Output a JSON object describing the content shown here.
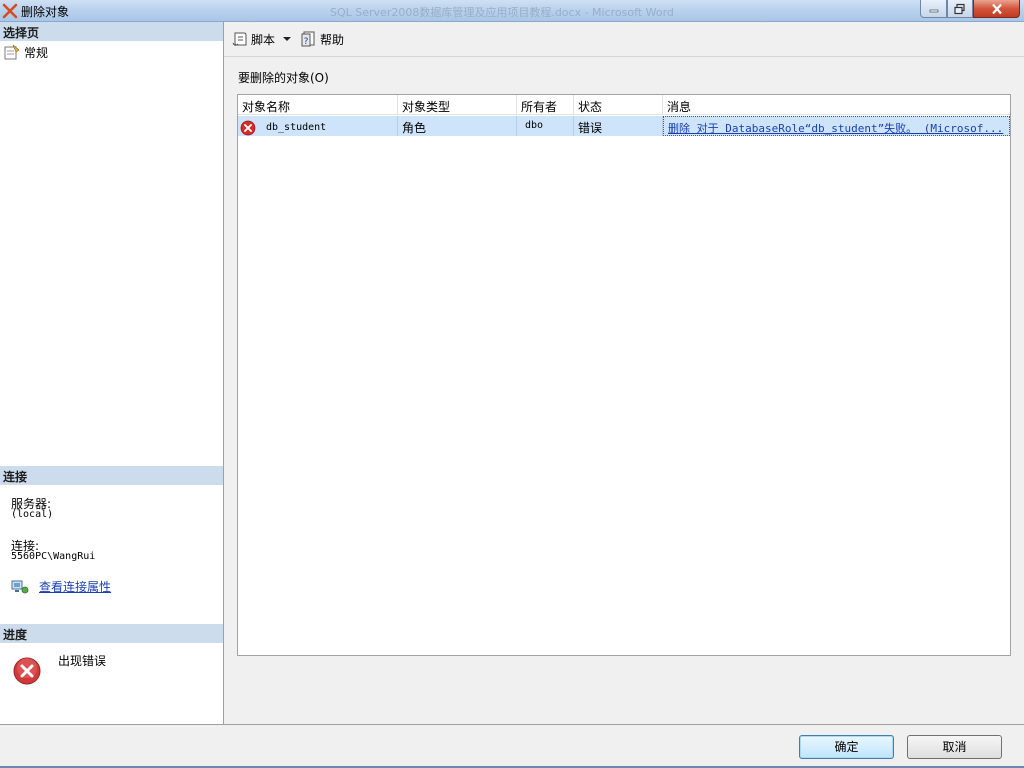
{
  "window": {
    "title": "删除对象",
    "background_title": "SQL Server2008数据库管理及应用项目教程.docx - Microsoft Word"
  },
  "left_panel": {
    "select_page_header": "选择页",
    "pages": [
      {
        "label": "常规",
        "icon": "page-settings-icon"
      }
    ],
    "connection_header": "连接",
    "server_label": "服务器:",
    "server_value": "(local)",
    "connection_label": "连接:",
    "connection_value": "5560PC\\WangRui",
    "view_connection_link": "查看连接属性",
    "progress_header": "进度",
    "progress_status": "出现错误"
  },
  "toolbar": {
    "script_label": "脚本",
    "help_label": "帮助"
  },
  "grid": {
    "title": "要删除的对象(O)",
    "columns": [
      "对象名称",
      "对象类型",
      "所有者",
      "状态",
      "消息"
    ],
    "rows": [
      {
        "name": "db_student",
        "type": "角色",
        "owner": "dbo",
        "status": "错误",
        "message": "删除 对于 DatabaseRole“db_student”失败。 (Microsof..."
      }
    ]
  },
  "buttons": {
    "ok": "确定",
    "cancel": "取消"
  },
  "colors": {
    "header_bg": "#cddced",
    "selected_row": "#cde4fb",
    "link": "#1a3fb6",
    "error_red": "#d42b2b"
  }
}
